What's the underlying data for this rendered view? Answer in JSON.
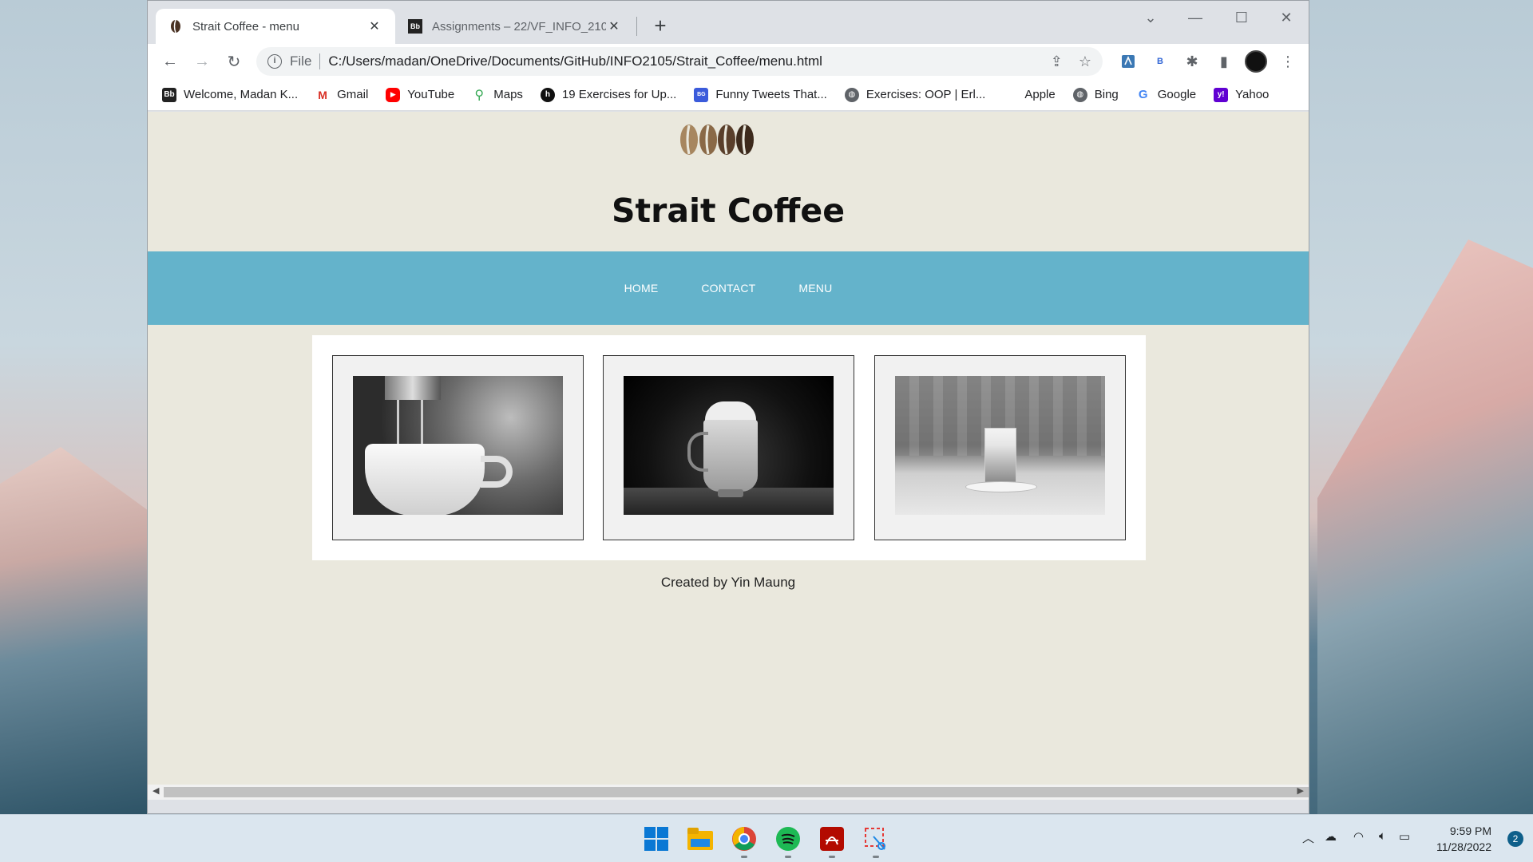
{
  "browser": {
    "tabs": [
      {
        "title": "Strait Coffee - menu",
        "active": true
      },
      {
        "title": "Assignments – 22/VF_INFO_2105",
        "active": false
      }
    ],
    "address": {
      "scheme": "File",
      "url": "C:/Users/madan/OneDrive/Documents/GitHub/INFO2105/Strait_Coffee/menu.html"
    },
    "bookmarks": [
      {
        "label": "Welcome, Madan K...",
        "icon": "blackboard-icon"
      },
      {
        "label": "Gmail",
        "icon": "gmail-icon"
      },
      {
        "label": "YouTube",
        "icon": "youtube-icon"
      },
      {
        "label": "Maps",
        "icon": "maps-icon"
      },
      {
        "label": "19 Exercises for Up...",
        "icon": "site-icon"
      },
      {
        "label": "Funny Tweets That...",
        "icon": "bookmark-icon"
      },
      {
        "label": "Exercises: OOP | Erl...",
        "icon": "globe-icon"
      },
      {
        "label": "Apple",
        "icon": "apple-icon"
      },
      {
        "label": "Bing",
        "icon": "globe-icon"
      },
      {
        "label": "Google",
        "icon": "google-icon"
      },
      {
        "label": "Yahoo",
        "icon": "yahoo-icon"
      }
    ]
  },
  "site": {
    "title": "Strait Coffee",
    "nav": [
      "HOME",
      "CONTACT",
      "MENU"
    ],
    "footer": "Created by Yin Maung",
    "gallery": [
      {
        "subject": "espresso machine pouring into cup"
      },
      {
        "subject": "glass mug latte with cream"
      },
      {
        "subject": "layered latte glass on saucer"
      }
    ],
    "colors": {
      "nav": "#64b3cb",
      "background": "#eae8dd"
    }
  },
  "taskbar": {
    "time": "9:59 PM",
    "date": "11/28/2022",
    "notifications": "2"
  }
}
